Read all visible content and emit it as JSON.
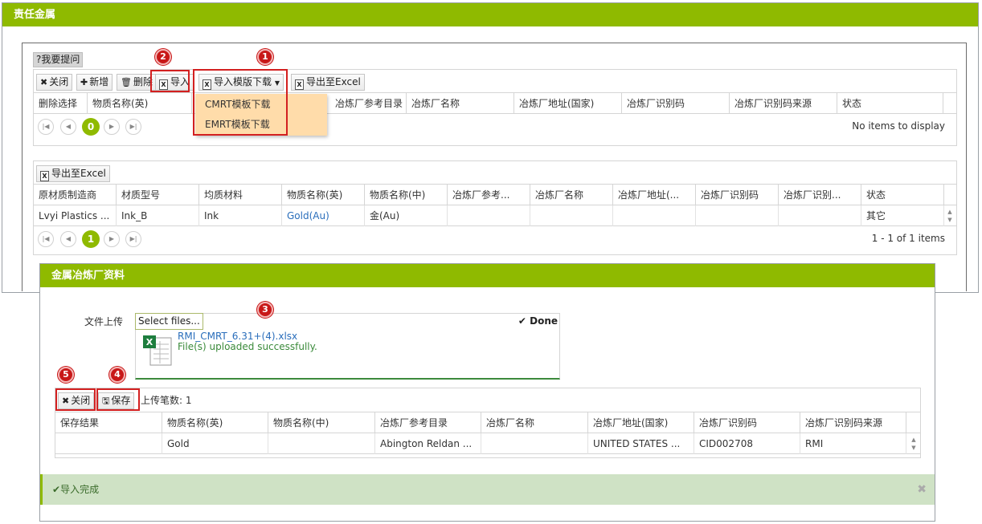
{
  "window1": {
    "title": "责任金属",
    "help": "?我要提问",
    "toolbar": {
      "close": "关闭",
      "add": "新增",
      "delete": "删除",
      "import": "导入",
      "template": "导入模版下载",
      "export": "导出至Excel"
    },
    "dropdown": [
      "CMRT模板下载",
      "EMRT模板下载"
    ],
    "grid1": {
      "columns": [
        "删除选择",
        "物质名称(英)",
        "冶炼厂参考目录",
        "冶炼厂名称",
        "冶炼厂地址(国家)",
        "冶炼厂识别码",
        "冶炼厂识别码来源",
        "状态"
      ],
      "page": "0",
      "info": "No items to display"
    },
    "grid2": {
      "export": "导出至Excel",
      "columns": [
        "原材质制造商",
        "材质型号",
        "均质材料",
        "物质名称(英)",
        "物质名称(中)",
        "冶炼厂参考...",
        "冶炼厂名称",
        "冶炼厂地址(...",
        "冶炼厂识别码",
        "冶炼厂识别...",
        "状态"
      ],
      "row": [
        "Lvyi Plastics ...",
        "Ink_B",
        "Ink",
        "Gold(Au)",
        "金(Au)",
        "",
        "",
        "",
        "",
        "",
        "其它"
      ],
      "page": "1",
      "info": "1 - 1 of 1 items"
    }
  },
  "window2": {
    "title": "金属冶炼厂资料",
    "upload_label": "文件上传",
    "select_files": "Select files...",
    "done": "Done",
    "file_name": "RMI_CMRT_6.31+(4).xlsx",
    "file_status": "File(s) uploaded successfully.",
    "toolbar": {
      "close": "关闭",
      "save": "保存",
      "count": "上传笔数: 1"
    },
    "grid3": {
      "columns": [
        "保存结果",
        "物质名称(英)",
        "物质名称(中)",
        "冶炼厂参考目录",
        "冶炼厂名称",
        "冶炼厂地址(国家)",
        "冶炼厂识别码",
        "冶炼厂识别码来源"
      ],
      "row": [
        "",
        "Gold",
        "",
        "Abington Reldan ...",
        "",
        "UNITED STATES ...",
        "CID002708",
        "RMI"
      ]
    },
    "success": "导入完成"
  },
  "badges": [
    "1",
    "2",
    "3",
    "4",
    "5"
  ],
  "colors": {
    "accent": "#8fba00",
    "annotation": "#d32020",
    "dropdown": "#ffdcaa",
    "success_bg": "#cfe2c5"
  }
}
